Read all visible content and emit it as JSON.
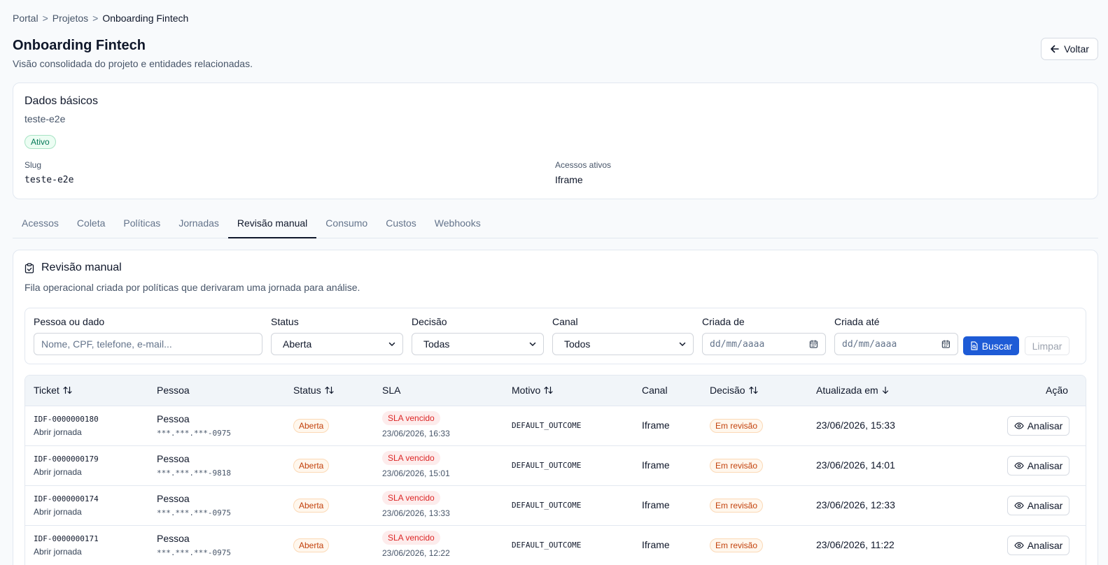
{
  "breadcrumb": {
    "items": [
      "Portal",
      "Projetos",
      "Onboarding Fintech"
    ],
    "separator": ">"
  },
  "header": {
    "title": "Onboarding Fintech",
    "subtitle": "Visão consolidada do projeto e entidades relacionadas.",
    "back_label": "Voltar"
  },
  "basic": {
    "title": "Dados básicos",
    "slug_sub": "teste-e2e",
    "status": "Ativo",
    "slug_label": "Slug",
    "slug_value": "teste-e2e",
    "access_label": "Acessos ativos",
    "access_value": "Iframe"
  },
  "tabs": {
    "items": [
      "Acessos",
      "Coleta",
      "Políticas",
      "Jornadas",
      "Revisão manual",
      "Consumo",
      "Custos",
      "Webhooks"
    ],
    "active": "Revisão manual"
  },
  "review": {
    "title": "Revisão manual",
    "description": "Fila operacional criada por políticas que derivaram uma jornada para análise."
  },
  "filters": {
    "person": {
      "label": "Pessoa ou dado",
      "placeholder": "Nome, CPF, telefone, e-mail..."
    },
    "status": {
      "label": "Status",
      "value": "Aberta"
    },
    "decision": {
      "label": "Decisão",
      "value": "Todas"
    },
    "channel": {
      "label": "Canal",
      "value": "Todos"
    },
    "created_from": {
      "label": "Criada de",
      "placeholder": "dd/mm/aaaa"
    },
    "created_to": {
      "label": "Criada até",
      "placeholder": "dd/mm/aaaa"
    },
    "search_label": "Buscar",
    "clear_label": "Limpar"
  },
  "table": {
    "columns": {
      "ticket": "Ticket",
      "person": "Pessoa",
      "status": "Status",
      "sla": "SLA",
      "reason": "Motivo",
      "channel": "Canal",
      "decision": "Decisão",
      "updated": "Atualizada em",
      "action": "Ação"
    },
    "rows": [
      {
        "ticket": "IDF-0000000180",
        "open": "Abrir jornada",
        "person": "Pessoa",
        "doc": "***.***.***-0975",
        "status": "Aberta",
        "sla": "SLA vencido",
        "sla_date": "23/06/2026, 16:33",
        "reason": "DEFAULT_OUTCOME",
        "channel": "Iframe",
        "decision": "Em revisão",
        "updated": "23/06/2026, 15:33",
        "action": "Analisar"
      },
      {
        "ticket": "IDF-0000000179",
        "open": "Abrir jornada",
        "person": "Pessoa",
        "doc": "***.***.***-9818",
        "status": "Aberta",
        "sla": "SLA vencido",
        "sla_date": "23/06/2026, 15:01",
        "reason": "DEFAULT_OUTCOME",
        "channel": "Iframe",
        "decision": "Em revisão",
        "updated": "23/06/2026, 14:01",
        "action": "Analisar"
      },
      {
        "ticket": "IDF-0000000174",
        "open": "Abrir jornada",
        "person": "Pessoa",
        "doc": "***.***.***-0975",
        "status": "Aberta",
        "sla": "SLA vencido",
        "sla_date": "23/06/2026, 13:33",
        "reason": "DEFAULT_OUTCOME",
        "channel": "Iframe",
        "decision": "Em revisão",
        "updated": "23/06/2026, 12:33",
        "action": "Analisar"
      },
      {
        "ticket": "IDF-0000000171",
        "open": "Abrir jornada",
        "person": "Pessoa",
        "doc": "***.***.***-0975",
        "status": "Aberta",
        "sla": "SLA vencido",
        "sla_date": "23/06/2026, 12:22",
        "reason": "DEFAULT_OUTCOME",
        "channel": "Iframe",
        "decision": "Em revisão",
        "updated": "23/06/2026, 11:22",
        "action": "Analisar"
      }
    ]
  },
  "icons": {
    "back": "arrow-left-icon",
    "review": "clipboard-check-icon",
    "search": "file-search-icon",
    "calendar": "calendar-icon",
    "select": "chevron-down-icon",
    "sort": "sort-icon",
    "sort_desc": "arrow-down-icon",
    "analyze": "eye-icon"
  },
  "colors": {
    "primary": "#1e5bd6",
    "active_badge": "#047857",
    "sla_overdue": "#dc2626",
    "status_open": "#c2410c"
  }
}
